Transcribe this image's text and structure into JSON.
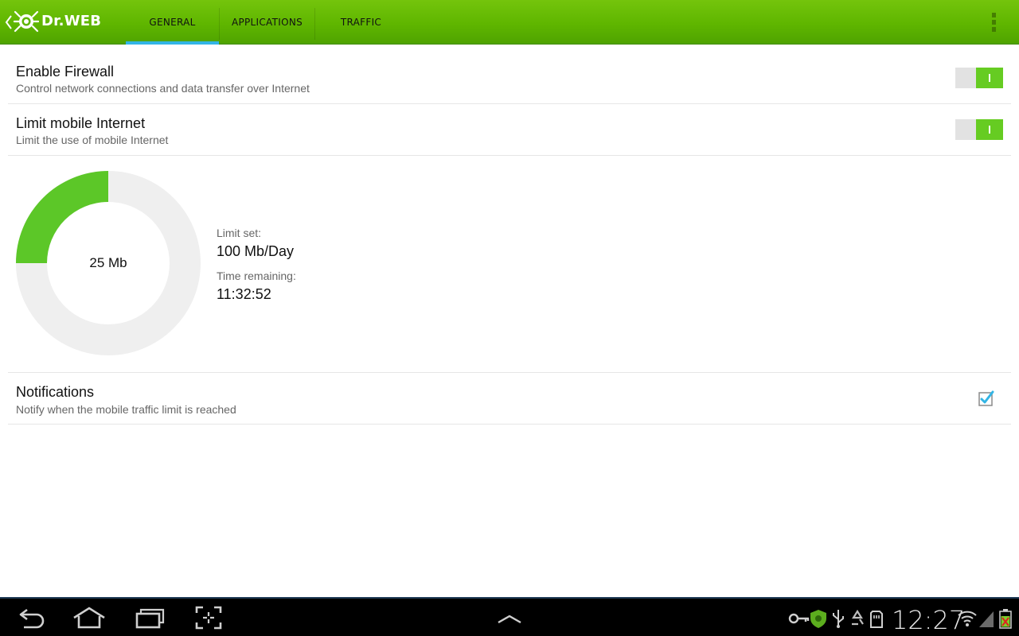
{
  "app": {
    "brand": "Dr.WEB"
  },
  "tabs": [
    {
      "label": "GENERAL",
      "selected": true
    },
    {
      "label": "APPLICATIONS",
      "selected": false
    },
    {
      "label": "TRAFFIC",
      "selected": false
    }
  ],
  "settings": {
    "firewall": {
      "title": "Enable Firewall",
      "summary": "Control network connections and data transfer over Internet",
      "enabled": true
    },
    "limit_mobile": {
      "title": "Limit mobile Internet",
      "summary": "Limit the use of mobile Internet",
      "enabled": true
    },
    "usage": {
      "used_label": "25 Mb",
      "used_mb": 25,
      "limit_mb": 100,
      "limit_set_label": "Limit set:",
      "limit_set_value": "100 Mb/Day",
      "time_remaining_label": "Time remaining:",
      "time_remaining_value": "11:32:52"
    },
    "notifications": {
      "title": "Notifications",
      "summary": "Notify when the mobile traffic limit is reached",
      "checked": true
    }
  },
  "system_bar": {
    "time": "12:27",
    "nav_icons": [
      "back-icon",
      "home-icon",
      "recent-apps-icon",
      "screenshot-icon",
      "up-arrow-icon"
    ],
    "status_icons": [
      "key-icon",
      "drweb-shield-icon",
      "usb-icon",
      "recycle-icon",
      "sd-card-icon",
      "wifi-icon",
      "signal-icon",
      "battery-icon"
    ]
  },
  "colors": {
    "actionbar_green": "#5fb600",
    "accent_blue": "#33b5e5",
    "switch_on": "#66cc22",
    "donut_used": "#5cc728",
    "donut_track": "#efefef"
  }
}
